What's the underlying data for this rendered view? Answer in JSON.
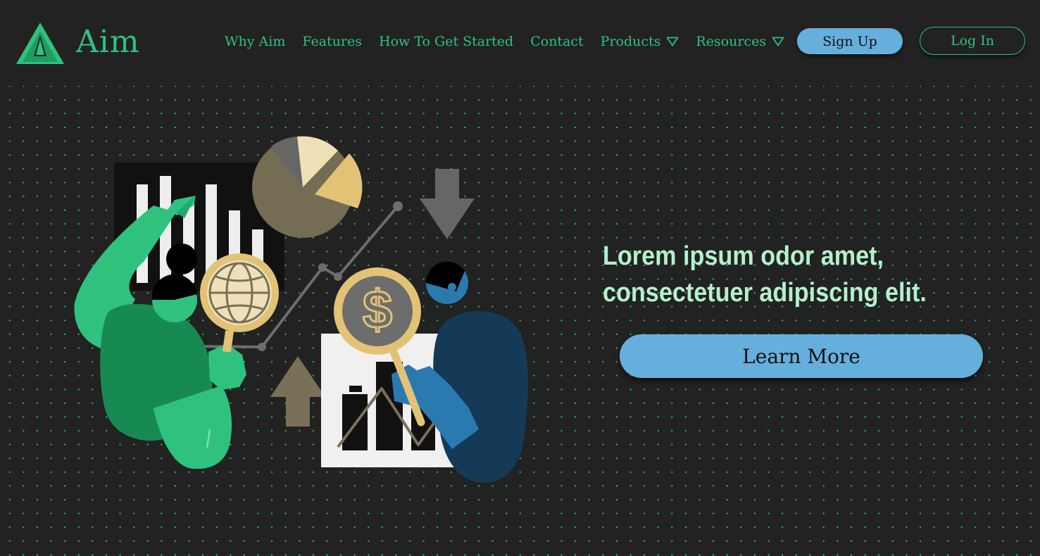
{
  "brand": {
    "name": "Aim",
    "logo_icon": "triangle-logo-icon"
  },
  "nav": {
    "items": [
      {
        "label": "Why Aim"
      },
      {
        "label": "Features"
      },
      {
        "label": "How To Get Started"
      },
      {
        "label": "Contact"
      },
      {
        "label": "Products",
        "dropdown_icon": "triangle-down-icon"
      },
      {
        "label": "Resources",
        "dropdown_icon": "triangle-down-icon"
      }
    ],
    "signup_label": "Sign Up",
    "login_label": "Log In"
  },
  "hero": {
    "title_line1": "Lorem ipsum odor amet,",
    "title_line2": "consectetuer adipiscing elit.",
    "cta_label": "Learn More",
    "illustration": "two-people-analyzing-finance-charts-illustration"
  },
  "colors": {
    "background": "#222222",
    "brand_green": "#2ec27e",
    "dot_grid": "#2ec27e",
    "hero_text": "#b4f0cc",
    "button_blue": "#66afdd",
    "illus_dark_green": "#178a53",
    "illus_navy": "#143a57",
    "illus_blue": "#2a7ab0",
    "illus_tan": "#e2c275",
    "illus_cream": "#f0e0b8",
    "illus_taupe": "#7a705a",
    "illus_gray": "#666666"
  }
}
